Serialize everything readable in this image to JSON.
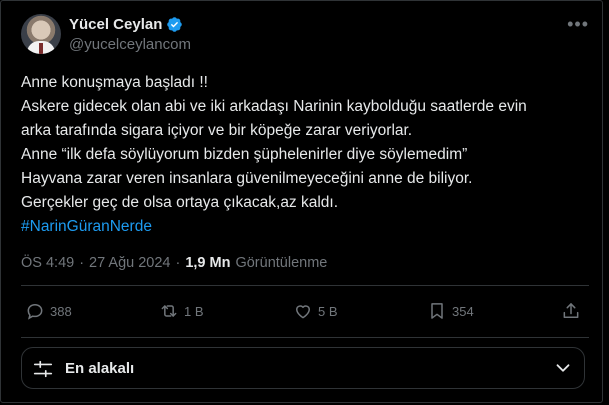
{
  "author": {
    "name": "Yücel Ceylan",
    "handle": "@yucelceylancom"
  },
  "tweet": {
    "lines": [
      "Anne konuşmaya başladı !!",
      "Askere gidecek olan abi ve iki arkadaşı Narinin kaybolduğu saatlerde evin",
      "arka tarafında sigara içiyor ve bir köpeğe zarar veriyorlar.",
      "Anne “ilk defa söylüyorum bizden şüphelenirler diye söylemedim”",
      "Hayvana zarar veren insanlara güvenilmeyeceğini anne de biliyor.",
      "Gerçekler geç de olsa ortaya çıkacak,az kaldı."
    ],
    "hashtag": "#NarinGüranNerde"
  },
  "meta": {
    "time": "ÖS 4:49",
    "sep1": "·",
    "date": "27 Ağu 2024",
    "sep2": "·",
    "views_count": "1,9 Mn",
    "views_label": "Görüntülenme"
  },
  "actions": {
    "replies": "388",
    "reposts": "1 B",
    "likes": "5 B",
    "bookmarks": "354"
  },
  "sort": {
    "label": "En alakalı"
  },
  "colors": {
    "background": "#000000",
    "text": "#e7e9ea",
    "muted": "#71767b",
    "accent": "#1d9bf0",
    "border": "#2f3336"
  },
  "icons": {
    "verified": "verified-badge-icon",
    "more": "more-options-icon",
    "reply": "reply-icon",
    "repost": "repost-icon",
    "like": "heart-icon",
    "bookmark": "bookmark-icon",
    "share": "share-icon",
    "sort": "sliders-icon",
    "chevron": "chevron-down-icon"
  }
}
